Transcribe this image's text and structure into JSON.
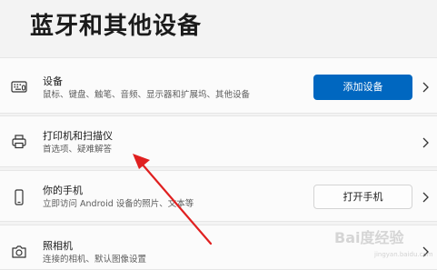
{
  "header": {
    "title": "蓝牙和其他设备"
  },
  "rows": [
    {
      "icon": "keyboard-icon",
      "title": "设备",
      "subtitle": "鼠标、键盘、触笔、音频、显示器和扩展坞、其他设备",
      "button": "添加设备"
    },
    {
      "icon": "printer-icon",
      "title": "打印机和扫描仪",
      "subtitle": "首选项、疑难解答"
    },
    {
      "icon": "phone-icon",
      "title": "你的手机",
      "subtitle": "立即访问 Android 设备的照片、文本等",
      "button": "打开手机"
    },
    {
      "icon": "camera-icon",
      "title": "照相机",
      "subtitle": "连接的相机、默认图像设置"
    }
  ],
  "annotation": {
    "arrow_color": "#e02020"
  },
  "watermark": {
    "text": "Bai度经验",
    "url": "jingyan.baidu.com"
  }
}
